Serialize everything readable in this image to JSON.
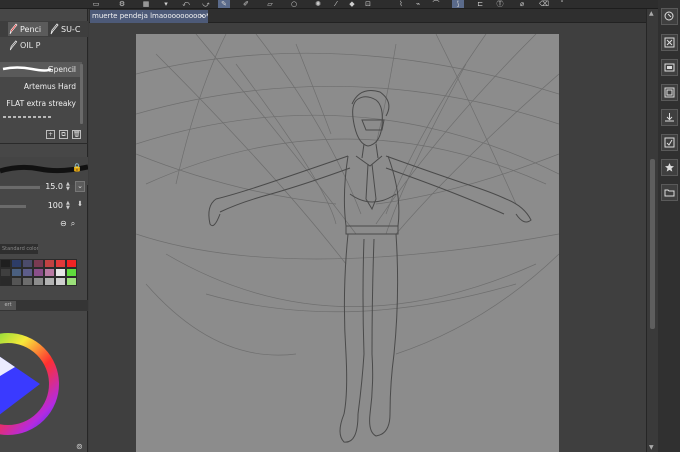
{
  "document": {
    "tab_title": "muerte pendeja lmaoooooooooo*",
    "close_glyph": "×"
  },
  "subtool": {
    "tabs": [
      {
        "label": "Penci",
        "icon": "pencil-tool-icon"
      },
      {
        "label": "SU-C",
        "icon": "pen-tool-icon"
      }
    ],
    "group_label": "OIL P",
    "brushes": [
      {
        "label": "Gpencil",
        "selected": true
      },
      {
        "label": "Artemus Hard",
        "selected": false
      },
      {
        "label": "FLAT extra streaky",
        "selected": false
      }
    ]
  },
  "tool_property": {
    "size_value": "15.0",
    "opacity_value": "100"
  },
  "color_set": {
    "header": "Standard color set",
    "swatches": [
      "#1f1f1f",
      "#2d3c66",
      "#4b4b6b",
      "#7a3a52",
      "#c24242",
      "#e23a3a",
      "#f02424",
      "#3f3f3f",
      "#4a5f7f",
      "#5d5d8a",
      "#8a4f8a",
      "#b87aa3",
      "#e6e6e6",
      "#5fdc3c",
      "#2a2a2a",
      "#555555",
      "#6d6d6d",
      "#8d8d8d",
      "#b2b2b2",
      "#cfcfcf",
      "#9be07a"
    ]
  },
  "color_wheel": {
    "tab_label": "ert",
    "hue": "#3a3aff"
  },
  "colors": {
    "canvas_paper": "#8c8c8c",
    "app_bg": "#3c3c3c",
    "accent": "#4d5a78"
  },
  "right_panel": {
    "icons": [
      "navigator-icon",
      "close-panel-icon",
      "layer-property-icon",
      "layer-icon",
      "download-material-icon",
      "material-icon",
      "favorite-icon",
      "folder-icon"
    ]
  }
}
